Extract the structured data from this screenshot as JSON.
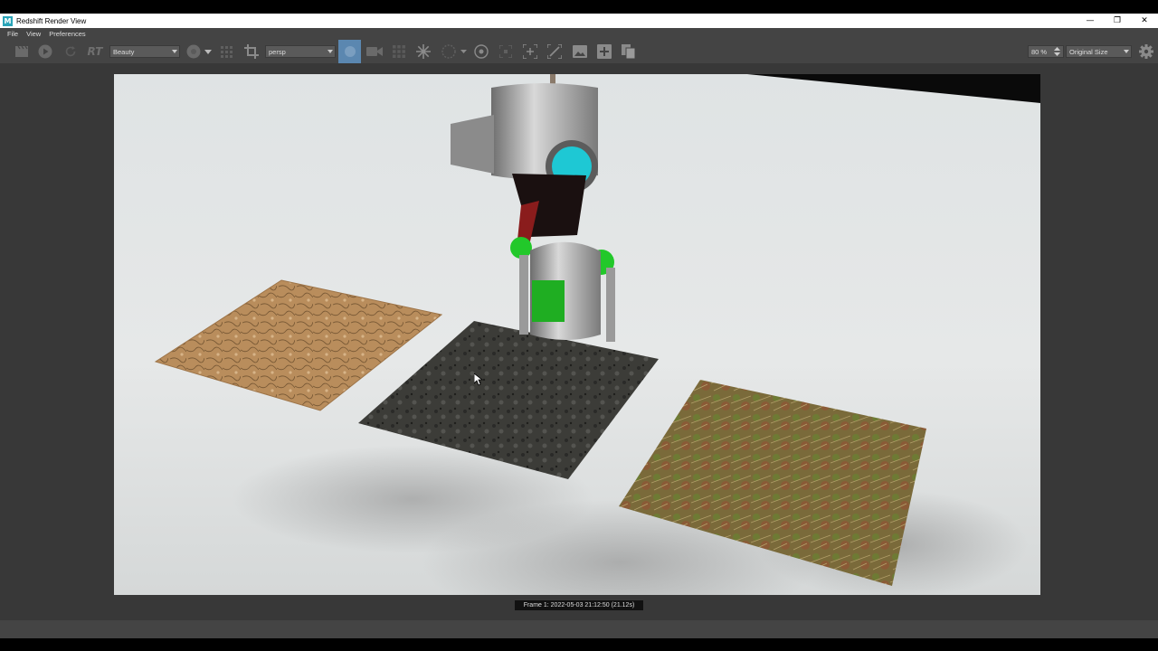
{
  "window": {
    "title": "Redshift Render View"
  },
  "window_controls": {
    "minimize": "—",
    "restore": "❐",
    "close": "✕"
  },
  "menu": {
    "items": [
      "File",
      "View",
      "Preferences"
    ]
  },
  "toolbar": {
    "rt_label": "RT",
    "aov_value": "Beauty",
    "camera_value": "persp",
    "zoom_value": "80 %",
    "size_value": "Original Size"
  },
  "status": {
    "frame_text": "Frame  1:  2022-05-03  21:12:50  (21.12s)"
  },
  "colors": {
    "accent_button": "#5b87b0",
    "toolbar_bg": "#444444",
    "viewport_bg": "#383838"
  }
}
